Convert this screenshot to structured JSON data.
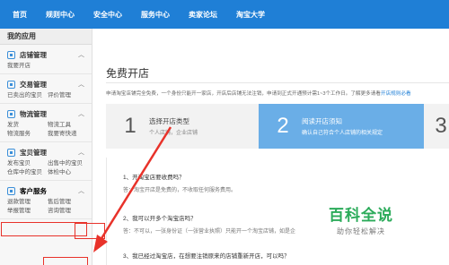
{
  "topnav": {
    "items": [
      "首页",
      "规则中心",
      "安全中心",
      "服务中心",
      "卖家论坛",
      "淘宝大学"
    ]
  },
  "sidebar": {
    "title": "我的应用",
    "groups": [
      {
        "label": "店铺管理",
        "links": [
          "我要开店"
        ]
      },
      {
        "label": "交易管理",
        "links": [
          "已卖出的宝贝",
          "评价管理"
        ]
      },
      {
        "label": "物流管理",
        "links": [
          "发货",
          "物流工具",
          "物流服务",
          "我要寄快递"
        ]
      },
      {
        "label": "宝贝管理",
        "links": [
          "发布宝贝",
          "出售中的宝贝",
          "仓库中的宝贝",
          "体检中心"
        ]
      },
      {
        "label": "客户服务",
        "links": [
          "退款管理",
          "售后管理",
          "举报管理",
          "咨询管理"
        ]
      }
    ]
  },
  "main": {
    "title": "免费开店",
    "notice": "申请淘宝店铺完全免费，一个身份只能开一家店，开店后店铺无法注销，申请到正式开通预计需1~3个工作日。了解更多请看",
    "notice_link": "开店规则必看",
    "steps": [
      {
        "num": "1",
        "title": "选择开店类型",
        "sub": "个人店铺，企业店铺"
      },
      {
        "num": "2",
        "title": "阅读开店须知",
        "sub": "确认自己符合个人店铺的相关规定"
      },
      {
        "num": "3",
        "title": "",
        "sub": ""
      }
    ],
    "questions": [
      {
        "q": "1、开淘宝店要收费吗？",
        "a": "答：淘宝开店是免费的，不收取任何服务费用。"
      },
      {
        "q": "2、我可以开多个淘宝店吗？",
        "a": "答：不可以，一张身份证（一张营业执照）只能开一个淘宝店铺，如是企"
      },
      {
        "q": "3、我已经过淘宝店，在想要注销原来的店铺重新开店，可以吗？",
        "a": ""
      }
    ]
  },
  "watermark": {
    "big": "百科全说",
    "small": "助你轻松解决"
  },
  "colors": {
    "nav": "#1f7fd6",
    "step_active": "#6aaee7",
    "highlight": "#e8322a",
    "watermark": "#2bab5a"
  }
}
